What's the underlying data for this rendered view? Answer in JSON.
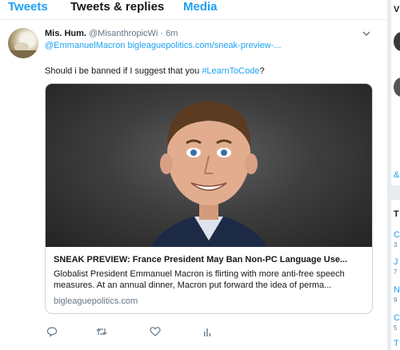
{
  "tabs": {
    "tweets": "Tweets",
    "replies": "Tweets & replies",
    "media": "Media"
  },
  "tweet": {
    "name": "Mis. Hum.",
    "handle": "@MisanthropicWi",
    "time": "· 6m",
    "replying_to": "@EmmanuelMacron  bigleaguepolitics.com/sneak-preview-...",
    "text_before": "Should i be banned if I suggest that you ",
    "hashtag": "#LearnToCode",
    "text_after": "?"
  },
  "card": {
    "title": "SNEAK PREVIEW: France President May Ban Non-PC Language Use...",
    "description": "Globalist President Emmanuel Macron is flirting with more anti-free speech measures. At an annual dinner, Macron put forward the idea of perma...",
    "domain": "bigleaguepolitics.com"
  },
  "right_column": {
    "top_letter": "V",
    "amp": "&",
    "trends_letter": "T",
    "trend_letters": [
      "C",
      "J",
      "N",
      "C",
      "T"
    ],
    "trend_digits": [
      "3",
      "7",
      "9",
      "5"
    ]
  },
  "colors": {
    "accent": "#1da1f2",
    "text": "#14171a",
    "muted": "#657786",
    "border": "#ccd6dd",
    "background": "#e6ecf0"
  },
  "icons": [
    "chevron-down-icon",
    "reply-icon",
    "retweet-icon",
    "like-icon",
    "analytics-icon"
  ]
}
